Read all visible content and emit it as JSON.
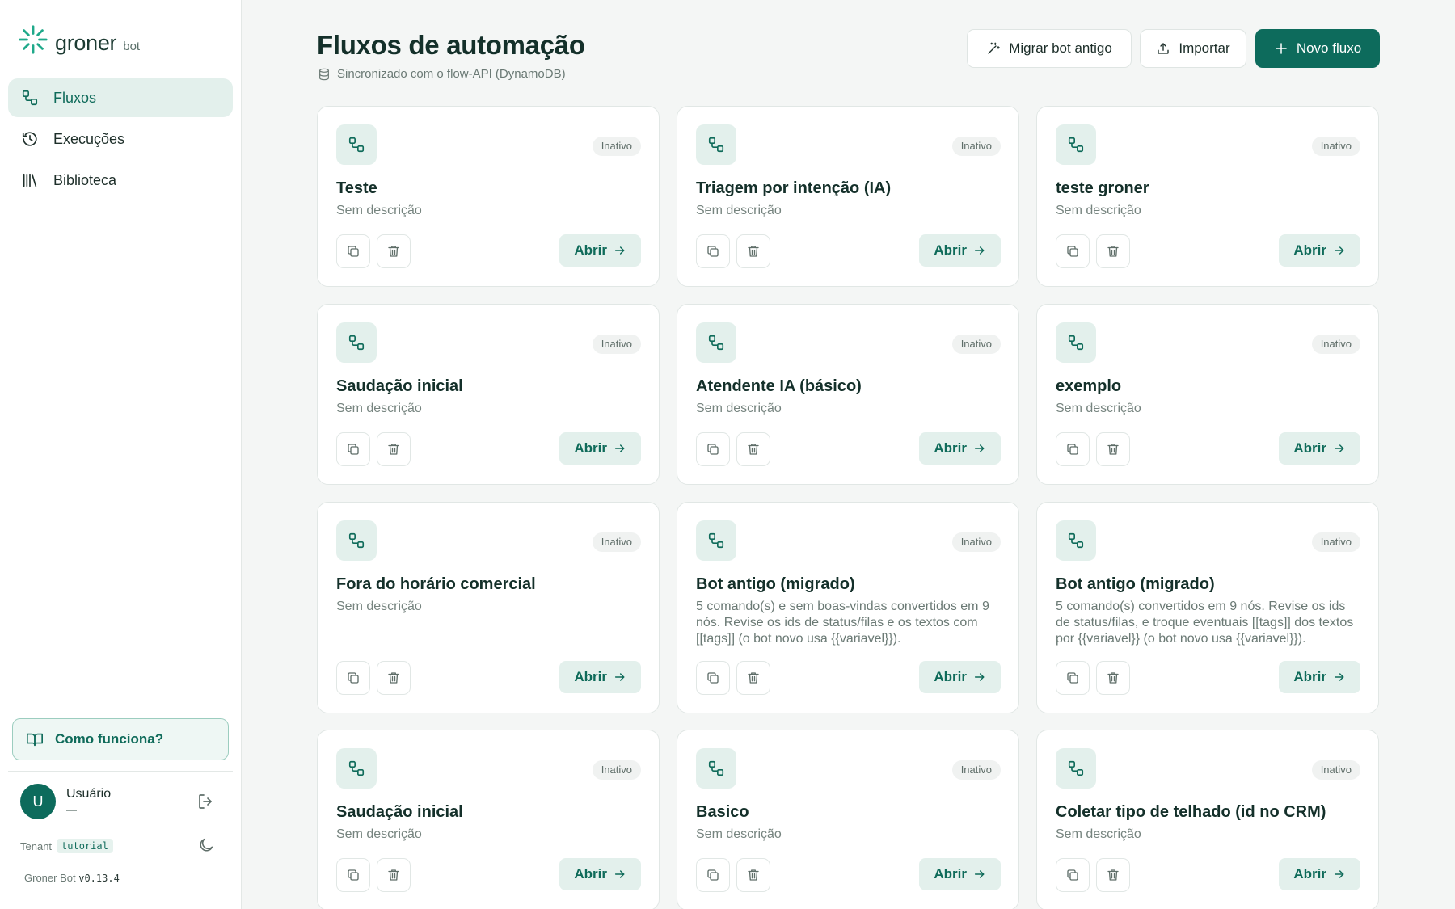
{
  "sidebar": {
    "brand": "groner",
    "brand_sub": "bot",
    "nav": [
      {
        "label": "Fluxos",
        "icon": "flow-icon",
        "active": true
      },
      {
        "label": "Execuções",
        "icon": "history-icon",
        "active": false
      },
      {
        "label": "Biblioteca",
        "icon": "library-icon",
        "active": false
      }
    ],
    "help_label": "Como funciona?",
    "user": {
      "initial": "U",
      "name": "Usuário",
      "sub": "—"
    },
    "tenant_label": "Tenant",
    "tenant_value": "tutorial",
    "version_label": "Groner Bot",
    "version_value": "v0.13.4"
  },
  "header": {
    "title": "Fluxos de automação",
    "subtitle": "Sincronizado com o flow-API (DynamoDB)",
    "buttons": {
      "migrar": "Migrar bot antigo",
      "importar": "Importar",
      "novo": "Novo fluxo"
    }
  },
  "colors": {
    "accent": "#0d6b5c",
    "accent_soft": "#e3f0ec",
    "background": "#f4f6f5"
  },
  "flows": [
    {
      "name": "Teste",
      "description": "Sem descrição",
      "status": "Inativo",
      "open_label": "Abrir"
    },
    {
      "name": "Triagem por intenção (IA)",
      "description": "Sem descrição",
      "status": "Inativo",
      "open_label": "Abrir"
    },
    {
      "name": "teste groner",
      "description": "Sem descrição",
      "status": "Inativo",
      "open_label": "Abrir"
    },
    {
      "name": "Saudação inicial",
      "description": "Sem descrição",
      "status": "Inativo",
      "open_label": "Abrir"
    },
    {
      "name": "Atendente IA (básico)",
      "description": "Sem descrição",
      "status": "Inativo",
      "open_label": "Abrir"
    },
    {
      "name": "exemplo",
      "description": "Sem descrição",
      "status": "Inativo",
      "open_label": "Abrir"
    },
    {
      "name": "Fora do horário comercial",
      "description": "Sem descrição",
      "status": "Inativo",
      "open_label": "Abrir"
    },
    {
      "name": "Bot antigo (migrado)",
      "description": "5 comando(s) e sem boas-vindas convertidos em 9 nós. Revise os ids de status/filas e os textos com [[tags]] (o bot novo usa {{variavel}}).",
      "status": "Inativo",
      "open_label": "Abrir"
    },
    {
      "name": "Bot antigo (migrado)",
      "description": "5 comando(s) convertidos em 9 nós. Revise os ids de status/filas, e troque eventuais [[tags]] dos textos por {{variavel}} (o bot novo usa {{variavel}}).",
      "status": "Inativo",
      "open_label": "Abrir"
    },
    {
      "name": "Saudação inicial",
      "description": "Sem descrição",
      "status": "Inativo",
      "open_label": "Abrir"
    },
    {
      "name": "Basico",
      "description": "Sem descrição",
      "status": "Inativo",
      "open_label": "Abrir"
    },
    {
      "name": "Coletar tipo de telhado (id no CRM)",
      "description": "Sem descrição",
      "status": "Inativo",
      "open_label": "Abrir"
    }
  ]
}
